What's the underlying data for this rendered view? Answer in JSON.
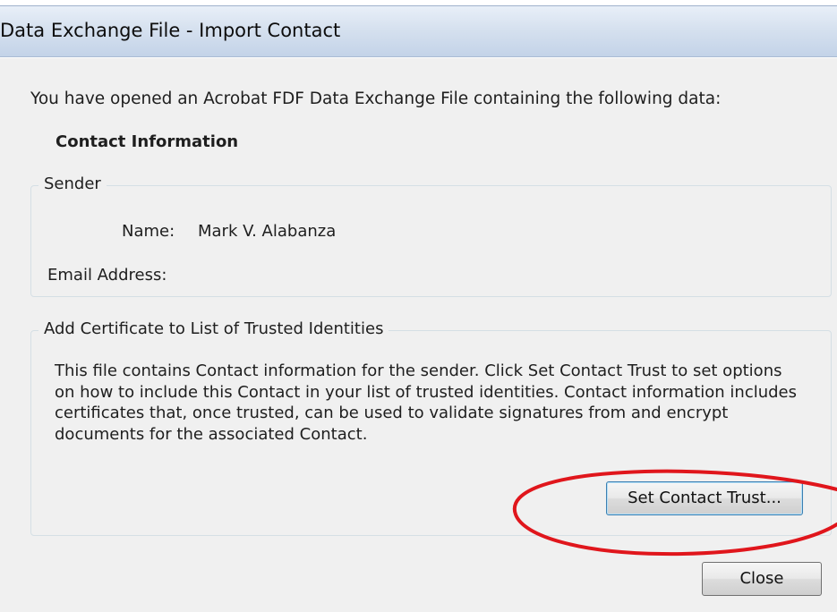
{
  "window": {
    "title": "Data Exchange File - Import Contact"
  },
  "dialog": {
    "intro": "You have opened an Acrobat FDF Data Exchange File containing the following data:",
    "section_heading": "Contact Information",
    "sender": {
      "legend": "Sender",
      "name_label": "Name:",
      "name_value": "Mark V. Alabanza",
      "email_label": "Email Address:",
      "email_value": ""
    },
    "certificate": {
      "legend": "Add Certificate to List of Trusted Identities",
      "description": "This file contains Contact information for the sender. Click Set Contact Trust to set options on how to include this Contact in your list of trusted identities. Contact information includes certificates that, once trusted, can be used to validate signatures from and encrypt documents for the associated Contact.",
      "set_trust_label": "Set Contact Trust..."
    },
    "close_label": "Close"
  },
  "colors": {
    "annotation": "#e0161c",
    "titlebar": "#d6e1ef",
    "dialog_bg": "#f0f0f0"
  }
}
